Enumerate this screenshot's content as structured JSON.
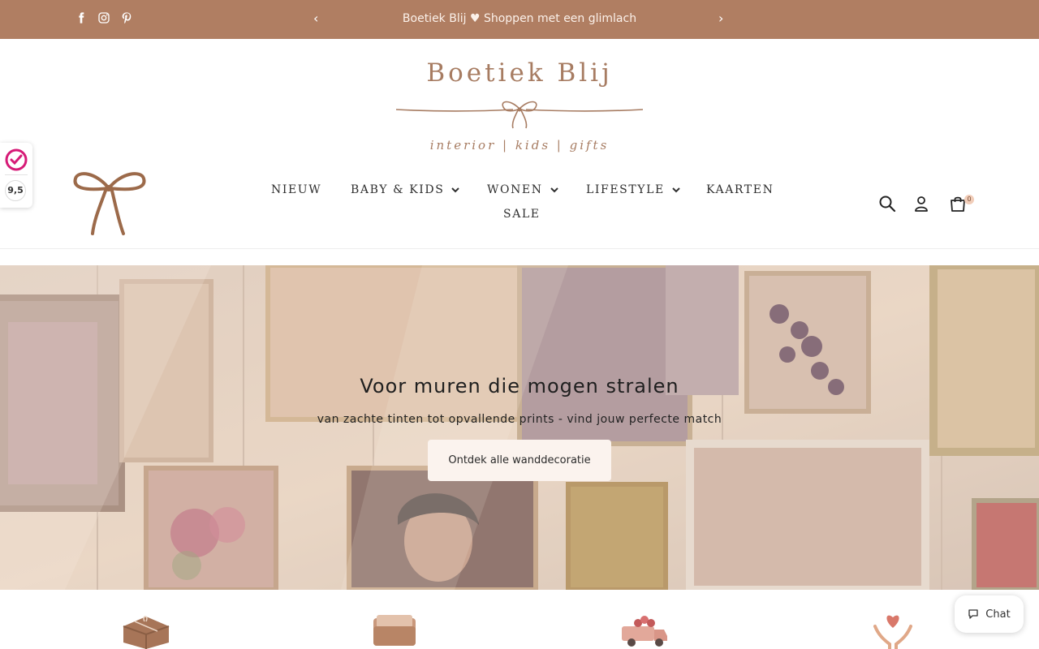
{
  "announcement": {
    "text": "Boetiek Blij ♥ Shoppen met een glimlach",
    "prev_label": "‹",
    "next_label": "›"
  },
  "social": [
    "facebook-icon",
    "instagram-icon",
    "pinterest-icon"
  ],
  "logo": {
    "name": "Boetiek Blij",
    "tagline": "interior | kids | gifts"
  },
  "rating": {
    "score": "9,5"
  },
  "nav": {
    "items": [
      {
        "label": "NIEUW",
        "has_dropdown": false
      },
      {
        "label": "BABY & KIDS",
        "has_dropdown": true
      },
      {
        "label": "WONEN",
        "has_dropdown": true
      },
      {
        "label": "LIFESTYLE",
        "has_dropdown": true
      },
      {
        "label": "KAARTEN",
        "has_dropdown": false
      },
      {
        "label": "SALE",
        "has_dropdown": false
      }
    ]
  },
  "header_icons": [
    "search-icon",
    "account-icon",
    "cart-icon"
  ],
  "cart": {
    "count": "0"
  },
  "hero": {
    "title": "Voor muren die mogen stralen",
    "subtitle": "van zachte tinten tot opvallende prints - vind jouw perfecte match",
    "button_label": "Ontdek alle wanddecoratie"
  },
  "usp_icons": [
    "gift-box-icon",
    "wallet-icon",
    "delivery-truck-icon",
    "heart-hands-icon"
  ],
  "chat": {
    "label": "Chat"
  },
  "colors": {
    "brand": "#b07e62",
    "logo_text": "#a77c62",
    "button_bg": "#fbf3ee",
    "cart_badge": "#f1cdb9"
  }
}
